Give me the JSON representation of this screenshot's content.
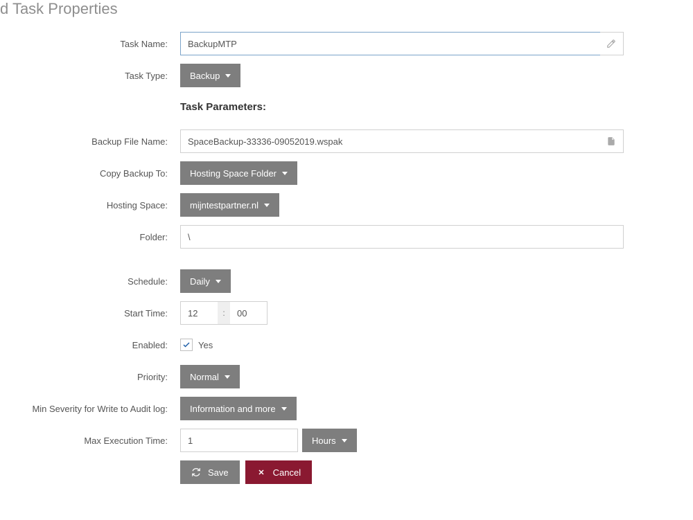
{
  "page": {
    "title": "d Task Properties"
  },
  "labels": {
    "task_name": "Task Name:",
    "task_type": "Task Type:",
    "task_parameters": "Task Parameters:",
    "backup_file_name": "Backup File Name:",
    "copy_backup_to": "Copy Backup To:",
    "hosting_space": "Hosting Space:",
    "folder": "Folder:",
    "schedule": "Schedule:",
    "start_time": "Start Time:",
    "enabled": "Enabled:",
    "priority": "Priority:",
    "min_severity": "Min Severity for Write to Audit log:",
    "max_execution_time": "Max Execution Time:"
  },
  "fields": {
    "task_name": "BackupMTP",
    "task_type": "Backup",
    "backup_file_name": "SpaceBackup-33336-09052019.wspak",
    "copy_backup_to": "Hosting Space Folder",
    "hosting_space": "mijntestpartner.nl",
    "folder": "\\",
    "schedule": "Daily",
    "start_time_h": "12",
    "start_time_sep": ":",
    "start_time_m": "00",
    "enabled_yes": "Yes",
    "priority": "Normal",
    "min_severity": "Information and more",
    "max_execution_value": "1",
    "max_execution_unit": "Hours"
  },
  "buttons": {
    "save": "Save",
    "cancel": "Cancel"
  }
}
